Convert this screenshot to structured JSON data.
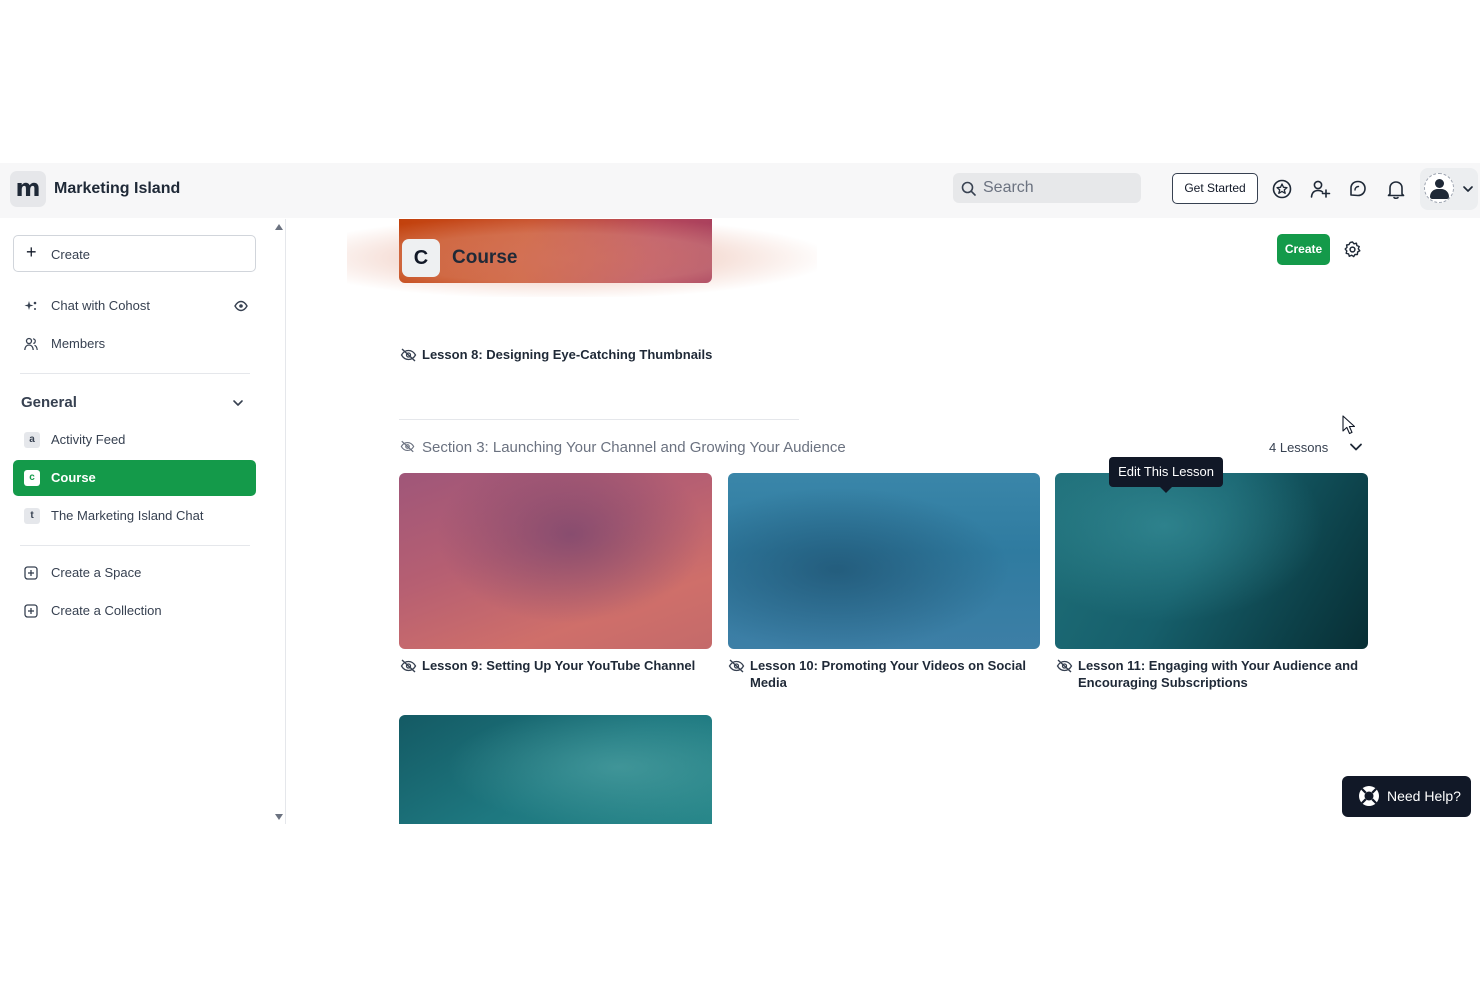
{
  "app": {
    "logo_letter": "m",
    "name": "Marketing Island"
  },
  "topbar": {
    "search_placeholder": "Search",
    "get_started_label": "Get Started",
    "icons": [
      "star-badge-icon",
      "add-member-icon",
      "chat-icon",
      "bell-icon",
      "avatar",
      "chevron-down-icon"
    ]
  },
  "sidebar": {
    "create_label": "Create",
    "chat_label": "Chat with Cohost",
    "members_label": "Members",
    "group_title": "General",
    "spaces": [
      {
        "letter": "a",
        "label": "Activity Feed"
      },
      {
        "letter": "c",
        "label": "Course"
      },
      {
        "letter": "t",
        "label": "The Marketing Island Chat"
      }
    ],
    "create_space_label": "Create a Space",
    "create_collection_label": "Create a Collection"
  },
  "main": {
    "course_letter": "C",
    "course_title": "Course",
    "create_label": "Create",
    "lesson8_title": "Lesson 8: Designing Eye-Catching Thumbnails",
    "section3": {
      "title": "Section 3: Launching Your Channel and Growing Your Audience",
      "lesson_count": "4 Lessons",
      "lessons": [
        {
          "title": "Lesson 9: Setting Up Your YouTube Channel"
        },
        {
          "title": "Lesson 10: Promoting Your Videos on Social Media"
        },
        {
          "title": "Lesson 11: Engaging with Your Audience and Encouraging Subscriptions"
        }
      ]
    },
    "tooltip": "Edit This Lesson"
  },
  "help": {
    "label": "Need Help?"
  },
  "colors": {
    "accent": "#149a4a",
    "dark": "#111827"
  }
}
